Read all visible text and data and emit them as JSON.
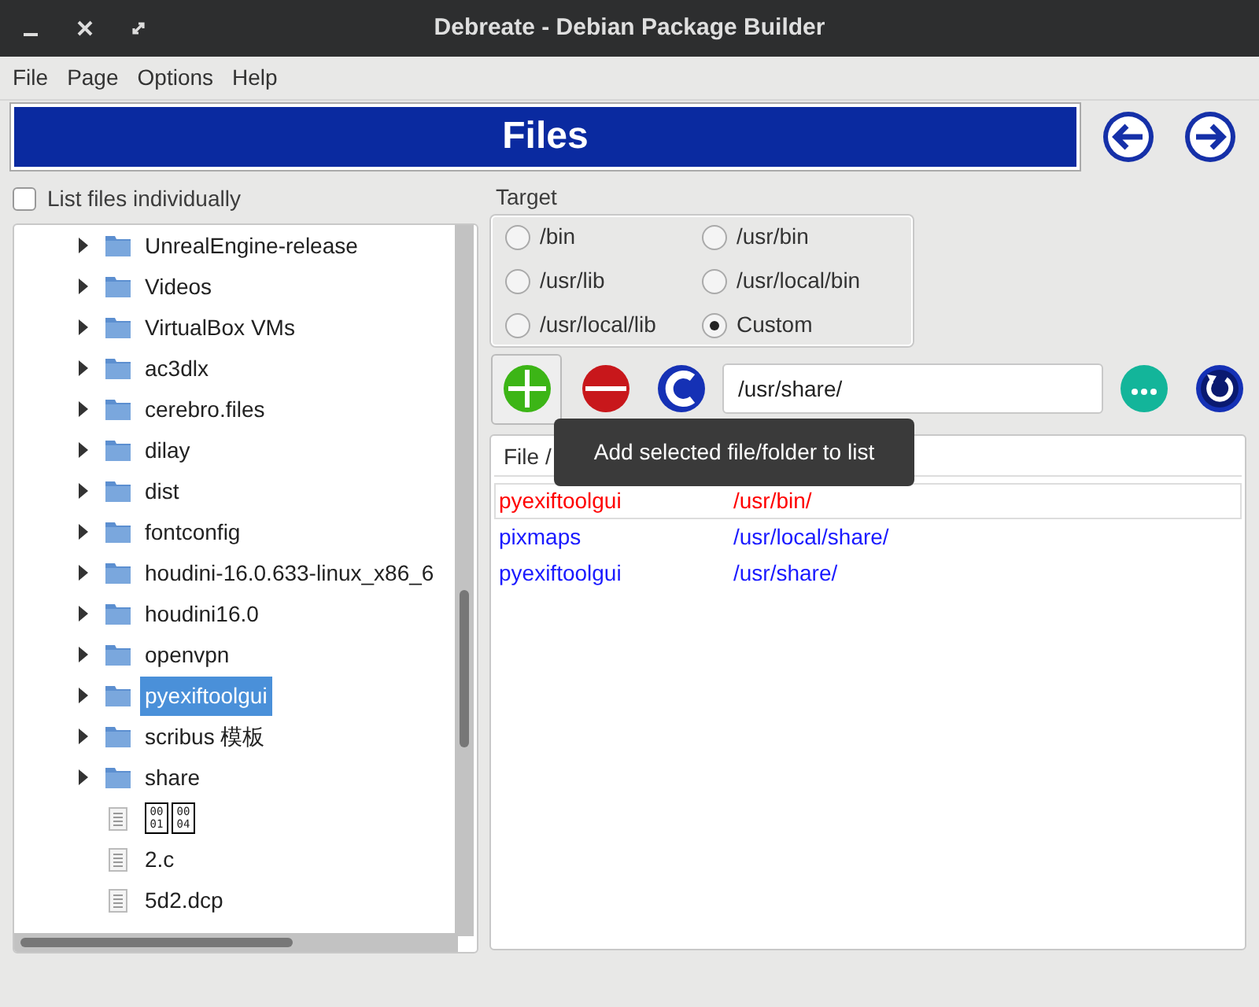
{
  "window": {
    "title": "Debreate - Debian Package Builder"
  },
  "menu": [
    "File",
    "Page",
    "Options",
    "Help"
  ],
  "banner": {
    "title": "Files"
  },
  "list_individually": {
    "label": "List files individually",
    "checked": false
  },
  "tree": [
    {
      "kind": "folder",
      "name": "UnrealEngine-release",
      "selected": false
    },
    {
      "kind": "folder",
      "name": "Videos",
      "selected": false
    },
    {
      "kind": "folder",
      "name": "VirtualBox VMs",
      "selected": false
    },
    {
      "kind": "folder",
      "name": "ac3dlx",
      "selected": false
    },
    {
      "kind": "folder",
      "name": "cerebro.files",
      "selected": false
    },
    {
      "kind": "folder",
      "name": "dilay",
      "selected": false
    },
    {
      "kind": "folder",
      "name": "dist",
      "selected": false
    },
    {
      "kind": "folder",
      "name": "fontconfig",
      "selected": false
    },
    {
      "kind": "folder",
      "name": "houdini-16.0.633-linux_x86_6",
      "selected": false
    },
    {
      "kind": "folder",
      "name": "houdini16.0",
      "selected": false
    },
    {
      "kind": "folder",
      "name": "openvpn",
      "selected": false
    },
    {
      "kind": "folder",
      "name": "pyexiftoolgui",
      "selected": true
    },
    {
      "kind": "folder",
      "name": "scribus 模板",
      "selected": false
    },
    {
      "kind": "folder",
      "name": "share",
      "selected": false
    },
    {
      "kind": "hexfile",
      "codes": [
        "0001",
        "0004"
      ],
      "selected": false
    },
    {
      "kind": "file",
      "name": "2.c",
      "selected": false
    },
    {
      "kind": "file",
      "name": "5d2.dcp",
      "selected": false
    }
  ],
  "target": {
    "label": "Target",
    "options": [
      {
        "label": "/bin",
        "selected": false
      },
      {
        "label": "/usr/bin",
        "selected": false
      },
      {
        "label": "/usr/lib",
        "selected": false
      },
      {
        "label": "/usr/local/bin",
        "selected": false
      },
      {
        "label": "/usr/local/lib",
        "selected": false
      },
      {
        "label": "Custom",
        "selected": true
      }
    ]
  },
  "custom_path": {
    "value": "/usr/share/"
  },
  "tooltip": "Add selected file/folder to list",
  "table": {
    "columns": [
      "File /"
    ],
    "rows": [
      {
        "file": "pyexiftoolgui",
        "target": "/usr/bin/",
        "color": "#ff0000",
        "selected": true
      },
      {
        "file": "pixmaps",
        "target": "/usr/local/share/",
        "color": "#1a1aff",
        "selected": false
      },
      {
        "file": "pyexiftoolgui",
        "target": "/usr/share/",
        "color": "#1a1aff",
        "selected": false
      }
    ]
  }
}
